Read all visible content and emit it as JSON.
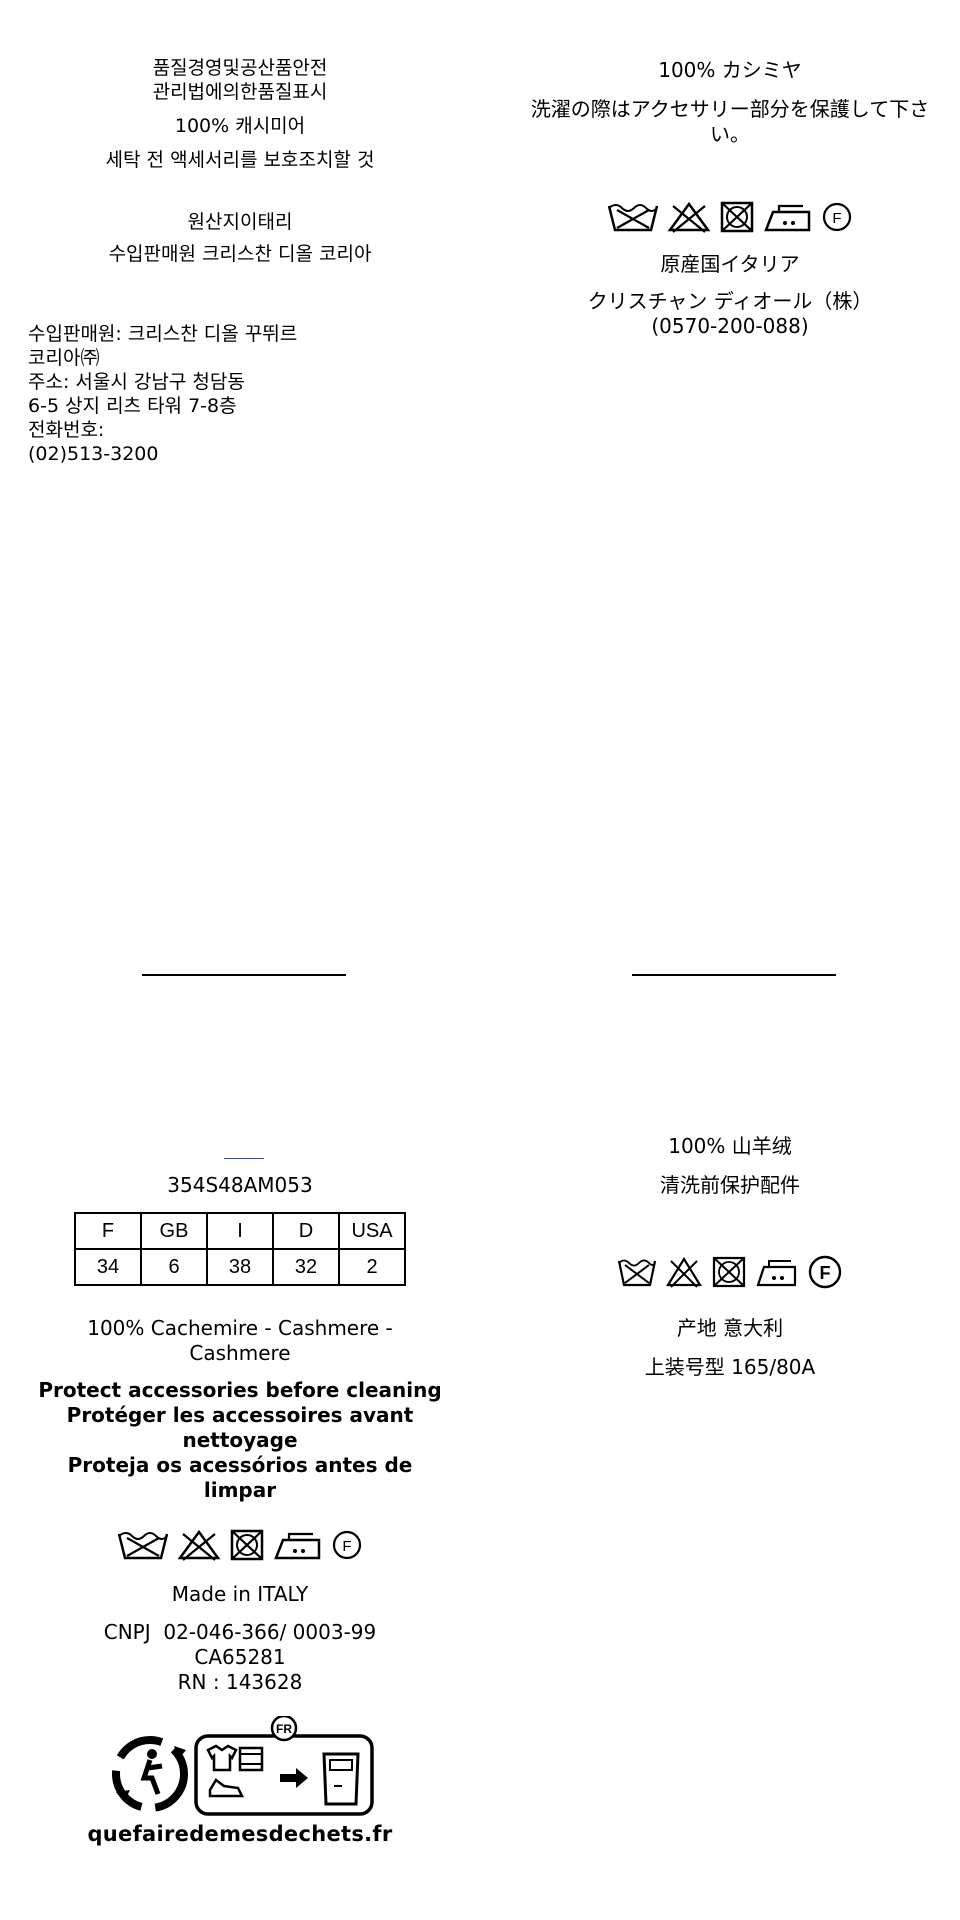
{
  "kr": {
    "title": [
      "품질경영및공산품안전",
      "관리법에의한품질표시"
    ],
    "composition": "100% 캐시미어",
    "care": "세탁 전 액세서리를 보호조치할 것",
    "origin": "원산지이태리",
    "importer_short": "수입판매원 크리스찬 디올 코리아",
    "importer_lines": [
      "수입판매원: 크리스찬 디올 꾸뛰르",
      "코리아㈜",
      "주소: 서울시 강남구 청담동",
      "6-5 상지 리츠 타워 7-8층",
      "전화번호:",
      "(02)513-3200"
    ]
  },
  "jp": {
    "composition": "100% カシミヤ",
    "care": [
      "洗濯の際はアクセサリー部分を保護して下さ",
      "い。"
    ],
    "origin": "原産国イタリア",
    "company": "クリスチャン ディオール（株）",
    "phone": "(0570-200-088)"
  },
  "intl": {
    "reference": "354S48AM053",
    "size_table": {
      "headers": [
        "F",
        "GB",
        "I",
        "D",
        "USA"
      ],
      "values": [
        "34",
        "6",
        "38",
        "32",
        "2"
      ]
    },
    "composition": [
      "100% Cachemire - Cashmere -",
      "Cashmere"
    ],
    "care_lines": [
      "Protect accessories before cleaning",
      "Protéger les accessoires avant",
      "nettoyage",
      "Proteja os acessórios antes de limpar"
    ],
    "made_in": "Made in ITALY",
    "cnpj": "CNPJ  02-046-366/ 0003-99",
    "ca": "CA65281",
    "rn": "RN : 143628",
    "recycle_badge": "FR",
    "recycle_url": "quefairedemesdechets.fr"
  },
  "cn": {
    "composition": "100% 山羊绒",
    "care": "清洗前保护配件",
    "origin": "产地 意大利",
    "size": "上装号型 165/80A"
  },
  "care_symbols": [
    "wash-30-icon",
    "no-bleach-icon",
    "no-tumble-dry-icon",
    "iron-medium-icon",
    "dry-clean-f-icon"
  ]
}
